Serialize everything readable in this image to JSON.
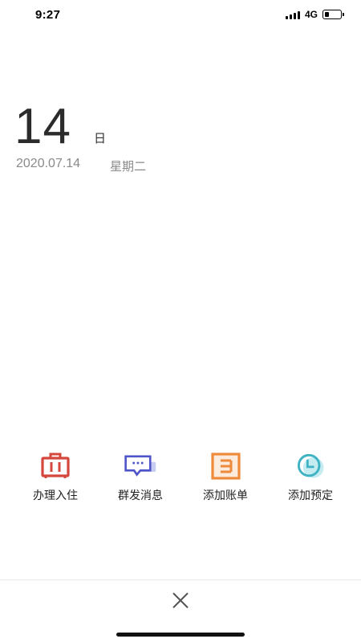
{
  "status_bar": {
    "time": "9:27",
    "network": "4G",
    "signal_bars": 4,
    "battery_level": 0.3
  },
  "date": {
    "day": "14",
    "day_unit": "日",
    "full_date": "2020.07.14",
    "weekday": "星期二"
  },
  "actions": [
    {
      "label": "办理入住",
      "icon": "luggage-icon",
      "color": "#d4473c"
    },
    {
      "label": "群发消息",
      "icon": "chat-bubble-icon",
      "color": "#4f55c9"
    },
    {
      "label": "添加账单",
      "icon": "bill-icon",
      "color": "#ee8a3c"
    },
    {
      "label": "添加预定",
      "icon": "clock-icon",
      "color": "#3fb3c4"
    }
  ],
  "close": {
    "icon": "close-icon"
  }
}
